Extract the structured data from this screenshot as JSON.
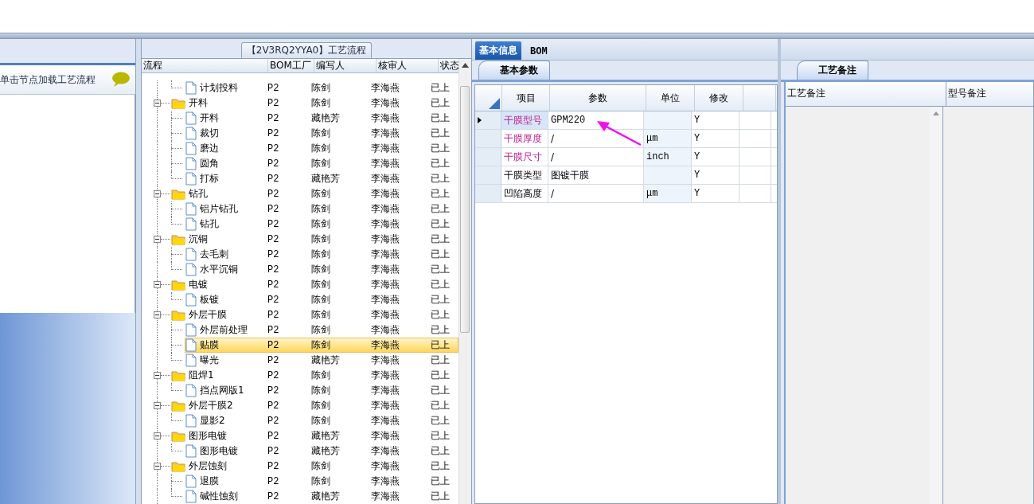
{
  "left_panel": {
    "hint": "单击节点加载工艺流程"
  },
  "flow_panel": {
    "title": "【2V3RQ2YYA0】工艺流程",
    "columns": [
      "流程",
      "BOM工厂",
      "编写人",
      "核审人",
      "状态"
    ],
    "tree": [
      {
        "children": [
          {
            "label": "计划投料",
            "bom": "P2",
            "writer": "陈剑",
            "reviewer": "李海燕",
            "status": "已上",
            "selected": false
          }
        ]
      },
      {
        "label": "开料",
        "bom": "P2",
        "writer": "陈剑",
        "reviewer": "李海燕",
        "status": "已上",
        "selected": false,
        "expanded": true,
        "children": [
          {
            "label": "开料",
            "bom": "P2",
            "writer": "藏艳芳",
            "reviewer": "李海燕",
            "status": "已上",
            "selected": false
          },
          {
            "label": "裁切",
            "bom": "P2",
            "writer": "陈剑",
            "reviewer": "李海燕",
            "status": "已上",
            "selected": false
          },
          {
            "label": "磨边",
            "bom": "P2",
            "writer": "陈剑",
            "reviewer": "李海燕",
            "status": "已上",
            "selected": false
          },
          {
            "label": "圆角",
            "bom": "P2",
            "writer": "陈剑",
            "reviewer": "李海燕",
            "status": "已上",
            "selected": false
          },
          {
            "label": "打标",
            "bom": "P2",
            "writer": "藏艳芳",
            "reviewer": "李海燕",
            "status": "已上",
            "selected": false
          }
        ]
      },
      {
        "label": "钻孔",
        "bom": "P2",
        "writer": "陈剑",
        "reviewer": "李海燕",
        "status": "已上",
        "selected": false,
        "expanded": true,
        "children": [
          {
            "label": "铝片钻孔",
            "bom": "P2",
            "writer": "陈剑",
            "reviewer": "李海燕",
            "status": "已上",
            "selected": false
          },
          {
            "label": "钻孔",
            "bom": "P2",
            "writer": "陈剑",
            "reviewer": "李海燕",
            "status": "已上",
            "selected": false
          }
        ]
      },
      {
        "label": "沉铜",
        "bom": "P2",
        "writer": "陈剑",
        "reviewer": "李海燕",
        "status": "已上",
        "selected": false,
        "expanded": true,
        "children": [
          {
            "label": "去毛刺",
            "bom": "P2",
            "writer": "陈剑",
            "reviewer": "李海燕",
            "status": "已上",
            "selected": false
          },
          {
            "label": "水平沉铜",
            "bom": "P2",
            "writer": "陈剑",
            "reviewer": "李海燕",
            "status": "已上",
            "selected": false
          }
        ]
      },
      {
        "label": "电镀",
        "bom": "P2",
        "writer": "陈剑",
        "reviewer": "李海燕",
        "status": "已上",
        "selected": false,
        "expanded": true,
        "children": [
          {
            "label": "板镀",
            "bom": "P2",
            "writer": "陈剑",
            "reviewer": "李海燕",
            "status": "已上",
            "selected": false
          }
        ]
      },
      {
        "label": "外层干膜",
        "bom": "P2",
        "writer": "陈剑",
        "reviewer": "李海燕",
        "status": "已上",
        "selected": false,
        "expanded": true,
        "children": [
          {
            "label": "外层前处理",
            "bom": "P2",
            "writer": "陈剑",
            "reviewer": "李海燕",
            "status": "已上",
            "selected": false
          },
          {
            "label": "贴膜",
            "bom": "P2",
            "writer": "陈剑",
            "reviewer": "李海燕",
            "status": "已上",
            "selected": true
          },
          {
            "label": "曝光",
            "bom": "P2",
            "writer": "藏艳芳",
            "reviewer": "李海燕",
            "status": "已上",
            "selected": false
          }
        ]
      },
      {
        "label": "阻焊1",
        "bom": "P2",
        "writer": "陈剑",
        "reviewer": "李海燕",
        "status": "已上",
        "selected": false,
        "expanded": true,
        "children": [
          {
            "label": "挡点网版1",
            "bom": "P2",
            "writer": "陈剑",
            "reviewer": "李海燕",
            "status": "已上",
            "selected": false
          }
        ]
      },
      {
        "label": "外层干膜2",
        "bom": "P2",
        "writer": "陈剑",
        "reviewer": "李海燕",
        "status": "已上",
        "selected": false,
        "expanded": true,
        "children": [
          {
            "label": "显影2",
            "bom": "P2",
            "writer": "陈剑",
            "reviewer": "李海燕",
            "status": "已上",
            "selected": false
          }
        ]
      },
      {
        "label": "图形电镀",
        "bom": "P2",
        "writer": "藏艳芳",
        "reviewer": "李海燕",
        "status": "已上",
        "selected": false,
        "expanded": true,
        "children": [
          {
            "label": "图形电镀",
            "bom": "P2",
            "writer": "藏艳芳",
            "reviewer": "李海燕",
            "status": "已上",
            "selected": false
          }
        ]
      },
      {
        "label": "外层蚀刻",
        "bom": "P2",
        "writer": "陈剑",
        "reviewer": "李海燕",
        "status": "已上",
        "selected": false,
        "expanded": true,
        "children": [
          {
            "label": "退膜",
            "bom": "P2",
            "writer": "陈剑",
            "reviewer": "李海燕",
            "status": "已上",
            "selected": false
          },
          {
            "label": "碱性蚀刻",
            "bom": "P2",
            "writer": "藏艳芳",
            "reviewer": "李海燕",
            "status": "已上",
            "selected": false
          }
        ]
      }
    ]
  },
  "info_panel": {
    "tabs": [
      {
        "label": "基本信息",
        "selected": true
      },
      {
        "label": "BOM",
        "selected": false
      }
    ],
    "subtab": "基本参数",
    "columns": [
      "项目",
      "参数",
      "单位",
      "修改"
    ],
    "rows": [
      {
        "item": "干膜型号",
        "value": "GPM220",
        "edit": "Y",
        "highlighted": true,
        "selected": true
      },
      {
        "item": "干膜厚度",
        "value": "/",
        "unit": "μm",
        "edit": "Y",
        "highlighted": true,
        "selected": false
      },
      {
        "item": "干膜尺寸",
        "value": "/",
        "unit": "inch",
        "edit": "Y",
        "highlighted": true,
        "selected": false
      },
      {
        "item": "干膜类型",
        "value": "图镀干膜",
        "edit": "Y",
        "highlighted": false,
        "selected": false
      },
      {
        "item": "凹陷高度",
        "value": "/",
        "unit": "μm",
        "edit": "Y",
        "highlighted": false,
        "selected": false
      }
    ]
  },
  "notes_panel": {
    "subtab": "工艺备注",
    "columns": [
      "工艺备注",
      "型号备注"
    ]
  }
}
